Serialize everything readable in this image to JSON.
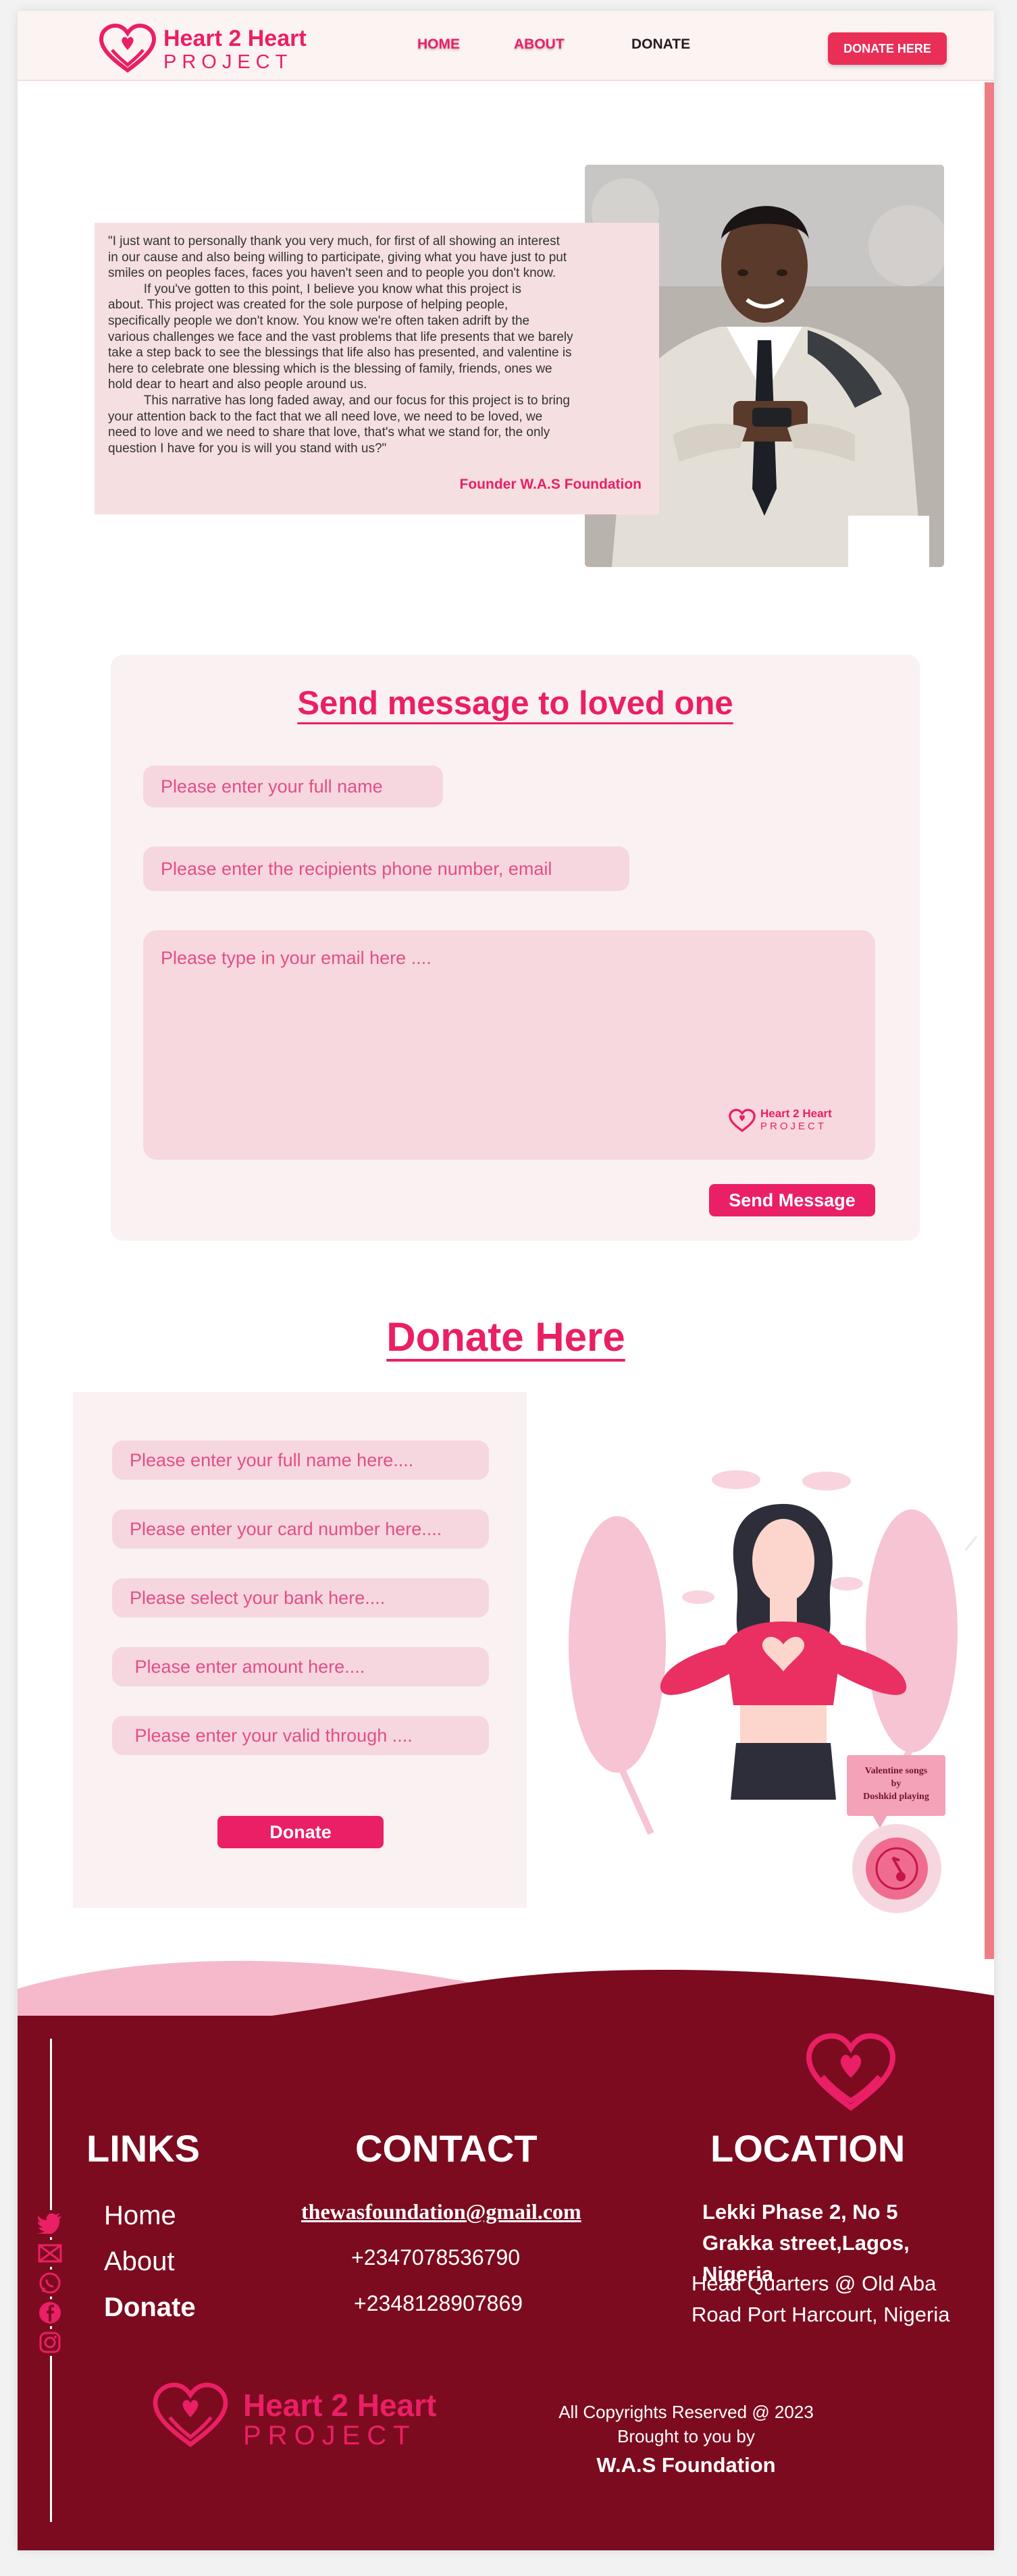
{
  "brand": {
    "title": "Heart 2 Heart",
    "subtitle": "PROJECT",
    "accent_color": "#ea1f65"
  },
  "nav": {
    "home": "HOME",
    "about": "ABOUT",
    "donate": "DONATE",
    "donate_button": "DONATE HERE"
  },
  "testimonial": {
    "text": "\"I just want to personally thank you very much, for first of all showing an interest\nin our cause and also being willing to participate, giving what you have just to put\nsmiles on peoples faces, faces you haven't seen and to people you don't know.\n          If you've gotten to this point, I believe you know what this project is\nabout. This project was created for the sole purpose of helping people,\nspecifically people we don't know. You know we're often taken adrift by the\nvarious challenges we face and the vast problems that life presents that we barely\ntake a step back to see the blessings that life also has presented, and valentine is\nhere to celebrate one blessing which is the blessing of family, friends, ones we\nhold dear to heart and also people around us.\n          This narrative has long faded away, and our focus for this project is to bring\nyour attention back to the fact that we all need love, we need to be loved, we\nneed to love and we need to share that love, that's what we stand for, the only\nquestion I have for you is will you stand with us?\"",
    "author": "Founder W.A.S Foundation"
  },
  "message_form": {
    "title": "Send message to loved one",
    "name_placeholder": "Please enter your full name",
    "recipient_placeholder": "Please enter the recipients phone number, email",
    "message_placeholder": "Please type in your email here ....",
    "logo_title": "Heart 2 Heart",
    "logo_subtitle": "PROJECT",
    "submit": "Send Message"
  },
  "donate_form": {
    "title": "Donate Here",
    "name_placeholder": "Please enter your full name here....",
    "card_placeholder": "Please enter your card number here....",
    "bank_placeholder": "Please select your bank here....",
    "amount_placeholder": " Please enter amount here....",
    "valid_placeholder": " Please enter your valid through ....",
    "submit": "Donate"
  },
  "music_widget": {
    "line1": "Valentine songs",
    "line2": "by",
    "line3": "Doshkid  playing"
  },
  "footer": {
    "links_heading": "LINKS",
    "links": [
      "Home",
      "About",
      "Donate"
    ],
    "contact_heading": "CONTACT",
    "email": "thewasfoundation@gmail.com",
    "phone1": "+2347078536790",
    "phone2": "+2348128907869",
    "location_heading": "LOCATION",
    "address": "Lekki Phase 2, No 5\nGrakka street,Lagos,\nNigeria",
    "hq": "Head Quarters @ Old Aba\nRoad Port Harcourt, Nigeria",
    "logo_title": "Heart 2 Heart",
    "logo_subtitle": "PROJECT",
    "copyright": "All Copyrights Reserved @ 2023",
    "brought_by": "Brought to you by",
    "org": "W.A.S Foundation",
    "social_icons": [
      "twitter-icon",
      "mail-icon",
      "whatsapp-icon",
      "facebook-icon",
      "instagram-icon"
    ]
  }
}
